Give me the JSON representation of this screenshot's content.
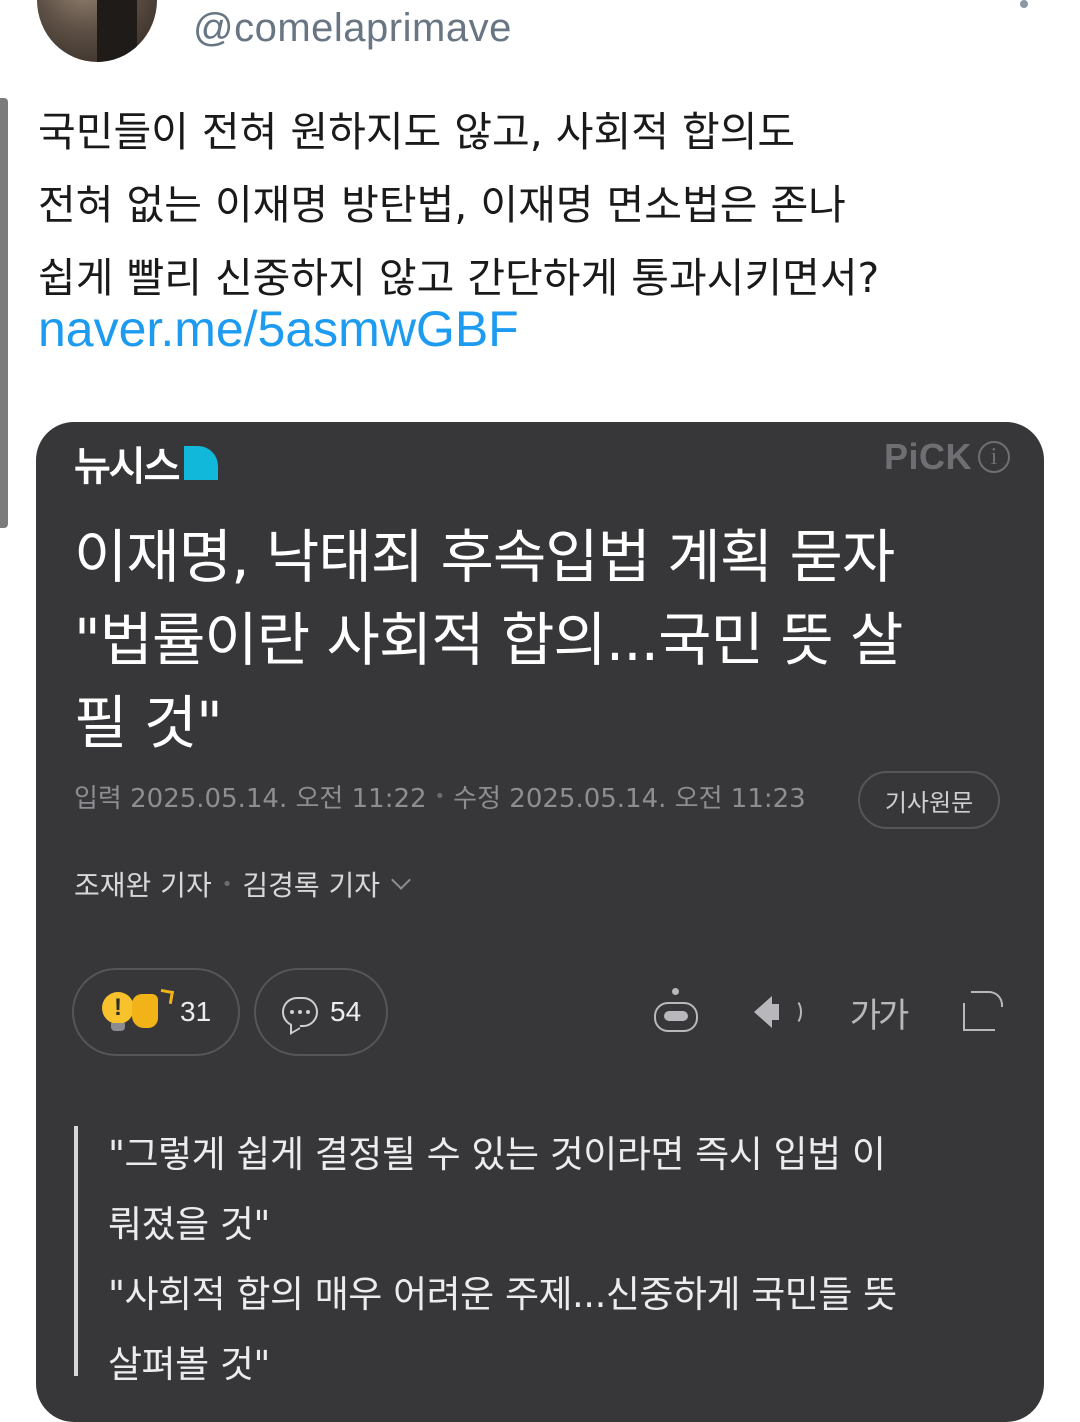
{
  "tweet": {
    "handle": "@comelaprimave",
    "text_lines": [
      "국민들이 전혀 원하지도 않고, 사회적 합의도",
      "전혀 없는 이재명 방탄법, 이재명 면소법은 존나",
      "쉽게 빨리 신중하지 않고 간단하게 통과시키면서?"
    ],
    "link": "naver.me/5asmwGBF"
  },
  "card": {
    "publisher": "뉴시스",
    "pick_label": "PiCK",
    "pick_info": "i",
    "headline_lines": [
      "이재명, 낙태죄 후속입법 계획 묻자",
      "\"법률이란 사회적 합의...국민 뜻 살",
      "필 것\""
    ],
    "published": "입력 2025.05.14. 오전 11:22",
    "modified": "수정 2025.05.14. 오전 11:23",
    "separator": "•",
    "original_button": "기사원문",
    "reporters": [
      "조재완 기자",
      "김경록 기자"
    ],
    "reaction_count": "31",
    "comment_count": "54",
    "font_tool_label": "가가",
    "quote_lines": [
      "\"그렇게 쉽게 결정될 수 있는 것이라면 즉시 입법 이",
      "뤄졌을 것\"",
      "\"사회적 합의 매우 어려운 주제...신중하게 국민들 뜻",
      "살펴볼 것\""
    ]
  },
  "colors": {
    "card_background": "#373739",
    "link": "#1d9bf0",
    "handle": "#687684",
    "publisher_accent": "#11b8d9"
  }
}
